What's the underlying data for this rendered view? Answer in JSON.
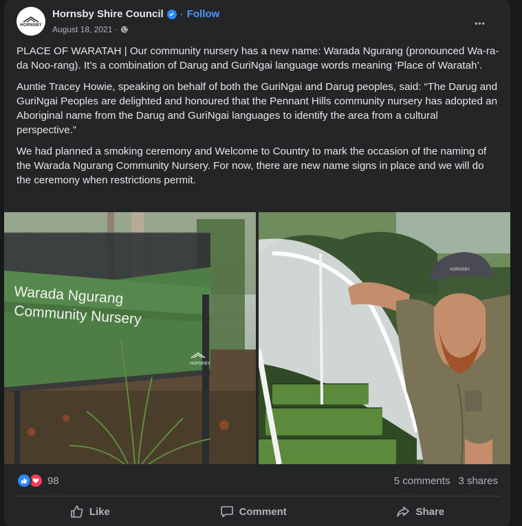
{
  "post": {
    "page_name": "Hornsby Shire Council",
    "follow_label": "Follow",
    "separator": "·",
    "date": "August 18, 2021",
    "date_separator": "·",
    "more_label": "•••",
    "avatar_text": "HORNSBY",
    "paragraphs": [
      "PLACE OF WARATAH | Our community nursery has a new name: Warada Ngurang (pronounced Wa-ra-da Noo-rang). It’s a combination of Darug and GuriNgai language words meaning ‘Place of Waratah’.",
      "Auntie Tracey Howie, speaking on behalf of both the GuriNgai and Darug peoples, said: “The Darug and GuriNgai Peoples are delighted and honoured that the Pennant Hills community nursery has adopted an Aboriginal name from the Darug and GuriNgai languages to identify the area from a cultural perspective.”",
      "We had planned a smoking ceremony and Welcome to Country to mark the occasion of the naming of the Warada Ngurang Community Nursery. For now, there are new name signs in place and we will do the ceremony when restrictions permit."
    ],
    "photo_left": {
      "sign_line1": "Warada Ngurang",
      "sign_line2": "Community Nursery",
      "sign_logo_text": "HORNSBY"
    },
    "photo_right": {
      "cap_text": "HORNSBY"
    },
    "reaction_count": "98",
    "comments": "5 comments",
    "shares": "3 shares",
    "actions": {
      "like": "Like",
      "comment": "Comment",
      "share": "Share"
    }
  },
  "colors": {
    "background": "#18191a",
    "card": "#242526",
    "text_primary": "#e4e6eb",
    "text_secondary": "#b0b3b8",
    "link": "#4599ff",
    "verified": "#2d88ff",
    "like": "#2d88ff",
    "love": "#f33e58",
    "sign_green": "#4e7d45"
  },
  "icons": {
    "verified": "verified-badge-icon",
    "privacy": "globe-icon",
    "more": "more-horizontal-icon",
    "like_reaction": "thumbs-up-icon",
    "love_reaction": "heart-icon",
    "like_action": "thumbs-up-outline-icon",
    "comment_action": "speech-bubble-icon",
    "share_action": "share-arrow-icon"
  }
}
